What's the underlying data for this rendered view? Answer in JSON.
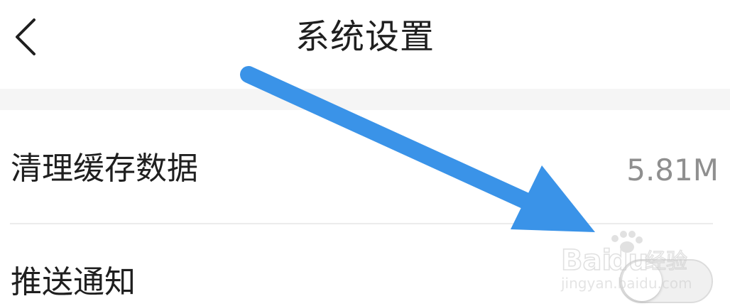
{
  "header": {
    "title": "系统设置",
    "back_icon": "chevron-left-icon"
  },
  "settings": {
    "cache": {
      "label": "清理缓存数据",
      "value": "5.81M"
    },
    "push": {
      "label": "推送通知",
      "toggle_state": "off"
    }
  },
  "overlay": {
    "annotation_arrow_color": "#3a93e8"
  },
  "watermark": {
    "brand": "Baidu经验",
    "url": "jingyan.baidu.com"
  },
  "colors": {
    "background": "#ffffff",
    "section_gap": "#f5f5f5",
    "text_primary": "#1f1f1f",
    "text_secondary": "#8f8f8f",
    "divider": "#ececec",
    "toggle_track": "#f0f0f0"
  }
}
